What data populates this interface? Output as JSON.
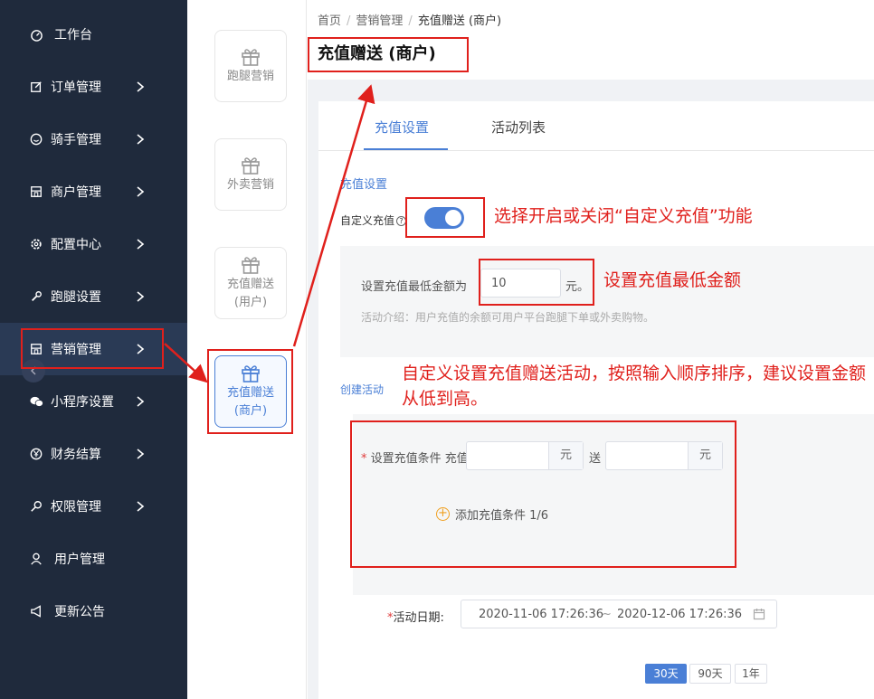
{
  "sidebar": {
    "items": [
      {
        "label": "工作台",
        "icon": "dashboard-icon",
        "arrow": false
      },
      {
        "label": "订单管理",
        "icon": "edit-icon",
        "arrow": true
      },
      {
        "label": "骑手管理",
        "icon": "smile-icon",
        "arrow": true
      },
      {
        "label": "商户管理",
        "icon": "shop-icon",
        "arrow": true
      },
      {
        "label": "配置中心",
        "icon": "gear-icon",
        "arrow": true
      },
      {
        "label": "跑腿设置",
        "icon": "wrench-icon",
        "arrow": true
      },
      {
        "label": "营销管理",
        "icon": "shop-icon",
        "arrow": true,
        "active": true
      },
      {
        "label": "小程序设置",
        "icon": "wechat-icon",
        "arrow": true
      },
      {
        "label": "财务结算",
        "icon": "yen-icon",
        "arrow": true
      },
      {
        "label": "权限管理",
        "icon": "key-icon",
        "arrow": true
      },
      {
        "label": "用户管理",
        "icon": "user-icon",
        "arrow": false
      },
      {
        "label": "更新公告",
        "icon": "megaphone-icon",
        "arrow": false
      }
    ]
  },
  "subnav": {
    "cards": [
      {
        "label": "跑腿营销"
      },
      {
        "label": "外卖营销"
      },
      {
        "label": "充值赠送 (用户)"
      },
      {
        "label": "充值赠送 (商户)",
        "active": true
      }
    ]
  },
  "breadcrumb": {
    "home": "首页",
    "section": "营销管理",
    "current": "充值赠送 (商户)",
    "sep": "/"
  },
  "page_title": "充值赠送 (商户)",
  "tabs": {
    "recharge_settings": "充值设置",
    "activity_list": "活动列表"
  },
  "form": {
    "section_title": "充值设置",
    "custom_recharge_label": "自定义充值",
    "custom_recharge_enabled": true,
    "min_amount_label": "设置充值最低金额为",
    "min_amount_value": "10",
    "min_amount_unit": "元。",
    "intro": "活动介绍：用户充值的余额可用户平台跑腿下单或外卖购物。",
    "create_activity_label": "创建活动",
    "condition_label": "设置充值条件",
    "recharge_label": "充值",
    "recharge_unit": "元",
    "give_label": "送",
    "give_unit": "元",
    "add_condition": "添加充值条件 1/6",
    "date_label": "活动日期:",
    "date_start": "2020-11-06 17:26:36",
    "date_sep": "~",
    "date_end": "2020-12-06 17:26:36",
    "period_buttons": [
      "30天",
      "90天",
      "1年"
    ],
    "period_selected": "30天"
  },
  "annotations": {
    "toggle_note": "选择开启或关闭“自定义充值”功能",
    "min_note": "设置充值最低金额",
    "activity_note": "自定义设置充值赠送活动，按照输入顺序排序，建议设置金额从低到高。"
  },
  "colors": {
    "sidebar_bg": "#1f2a3c",
    "accent": "#4a7fd6",
    "annotation_red": "#e0201c"
  }
}
